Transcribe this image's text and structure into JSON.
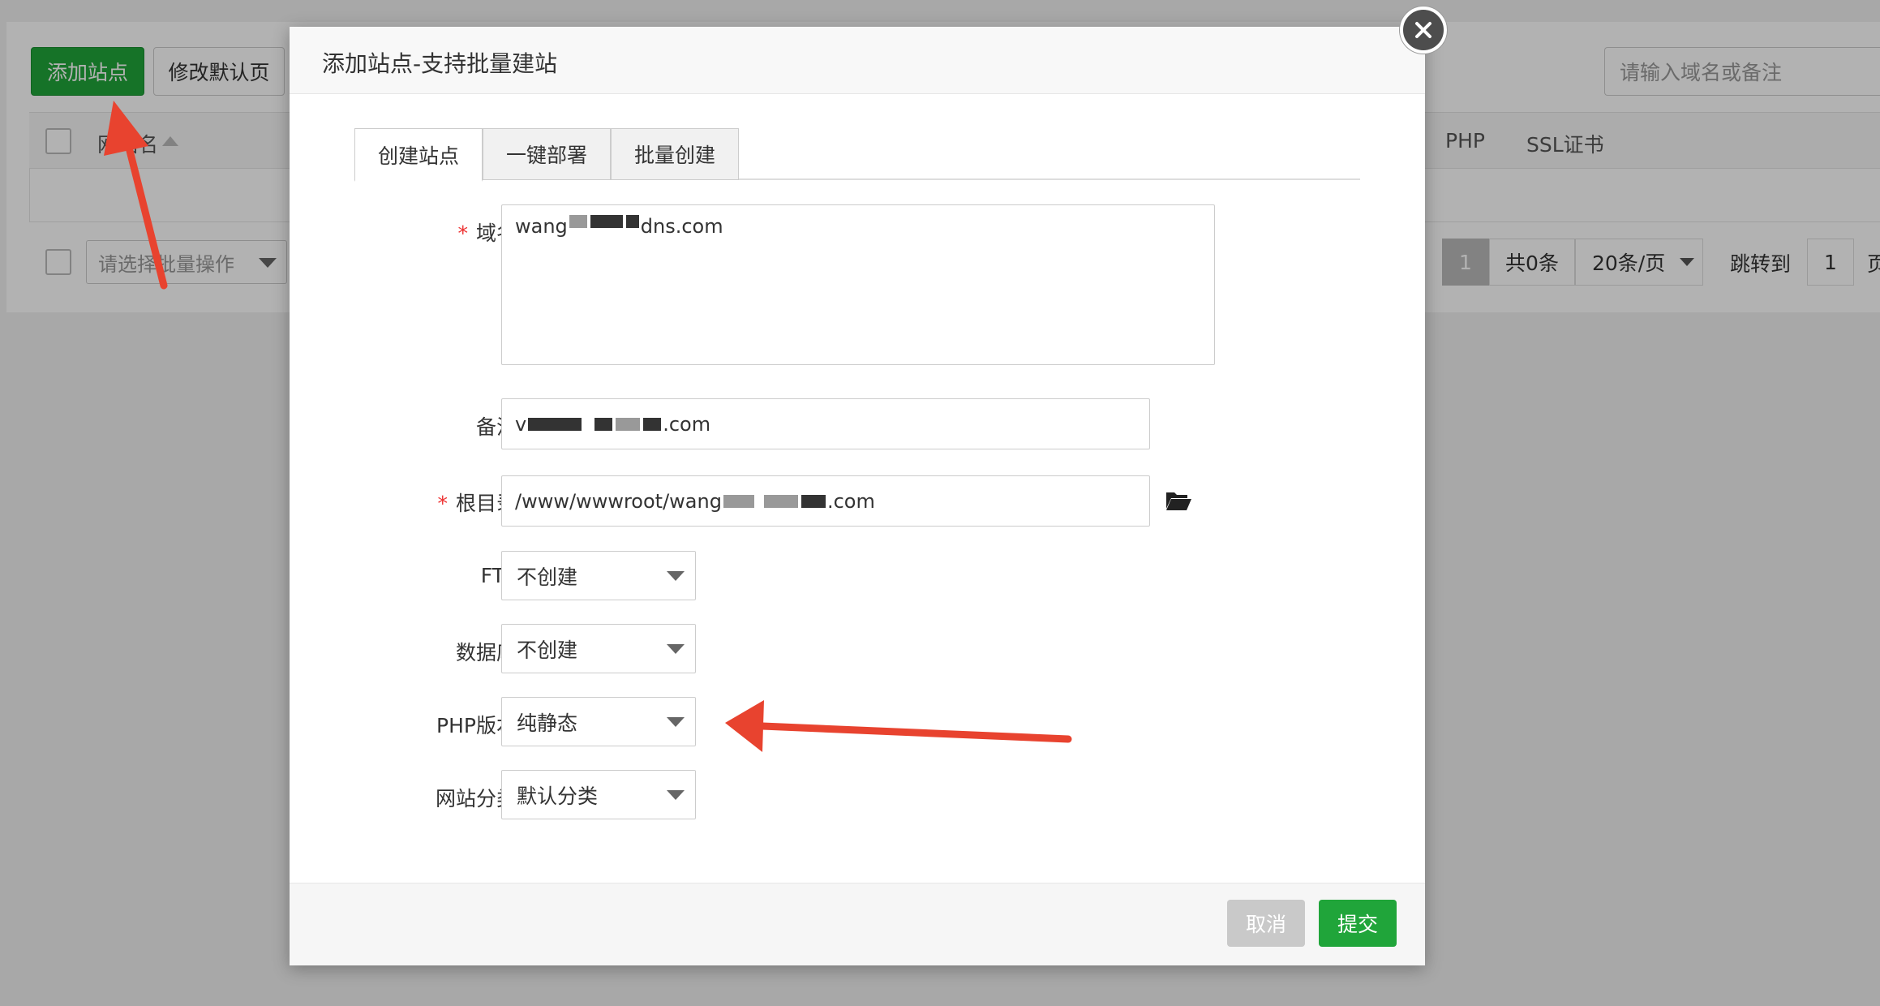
{
  "background": {
    "toolbar": {
      "add_site_label": "添加站点",
      "edit_default_page_label": "修改默认页",
      "search_placeholder": "请输入域名或备注"
    },
    "table": {
      "col_site_name": "网站名",
      "col_php": "PHP",
      "col_ssl": "SSL证书"
    },
    "batch_select_placeholder": "请选择批量操作",
    "pager": {
      "current_page": "1",
      "total": "共0条",
      "per_page": "20条/页",
      "jump_label": "跳转到",
      "jump_value": "1",
      "page_suffix": "页"
    }
  },
  "modal": {
    "title": "添加站点-支持批量建站",
    "tabs": [
      {
        "label": "创建站点",
        "active": true
      },
      {
        "label": "一键部署",
        "active": false
      },
      {
        "label": "批量创建",
        "active": false
      }
    ],
    "form": {
      "domain": {
        "label": "域名",
        "required": true,
        "value_prefix": "wang",
        "value_suffix": "dns.com"
      },
      "remark": {
        "label": "备注",
        "value_prefix": "v",
        "value_suffix": ".com"
      },
      "root_dir": {
        "label": "根目录",
        "required": true,
        "value_prefix": "/www/wwwroot/wang",
        "value_suffix": ".com"
      },
      "ftp": {
        "label": "FTP",
        "value": "不创建"
      },
      "database": {
        "label": "数据库",
        "value": "不创建"
      },
      "php_version": {
        "label": "PHP版本",
        "value": "纯静态"
      },
      "site_category": {
        "label": "网站分类",
        "value": "默认分类"
      }
    },
    "footer": {
      "cancel_label": "取消",
      "submit_label": "提交"
    }
  },
  "colors": {
    "green": "#20a53a",
    "annotation_red": "#e8432f",
    "cancel_gray": "#c9c9c9"
  }
}
